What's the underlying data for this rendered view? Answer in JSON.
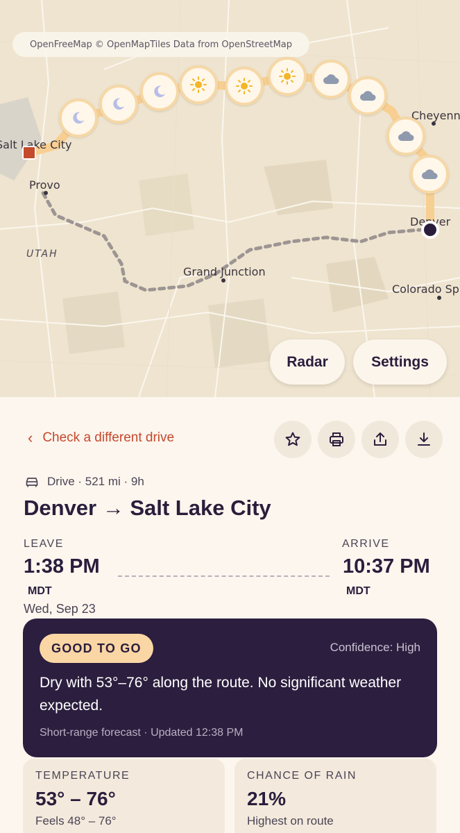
{
  "map": {
    "attribution": "OpenFreeMap © OpenMapTiles Data from OpenStreetMap",
    "cities": [
      "Salt Lake City",
      "Provo",
      "Grand Junction",
      "Cheyenne",
      "Denver",
      "Colorado Springs"
    ],
    "city_labels": {
      "salt_lake": "Salt Lake City",
      "provo": "Provo",
      "grand_junction": "Grand Junction",
      "cheyenne": "Cheyenn",
      "denver": "Denver",
      "colorado_springs": "Colorado Sp"
    },
    "state_label": "UTAH",
    "weather_markers": [
      "moon-icon",
      "moon-icon",
      "moon-icon",
      "sun-icon",
      "sun-icon",
      "sun-icon",
      "cloud-icon",
      "cloud-icon",
      "cloud-icon",
      "cloud-icon"
    ],
    "radar_label": "Radar",
    "settings_label": "Settings"
  },
  "nav": {
    "back_label": "Check a different drive"
  },
  "actions": [
    "star-icon",
    "print-icon",
    "share-icon",
    "download-icon"
  ],
  "trip": {
    "meta": "Drive · 521 mi · 9h",
    "title": "Denver → Salt Lake City",
    "leave_label": "LEAVE",
    "leave_time": "1:38 PM",
    "leave_tz": "MDT",
    "leave_date": "Wed, Sep 23",
    "arrive_label": "ARRIVE",
    "arrive_time": "10:37 PM",
    "arrive_tz": "MDT"
  },
  "verdict": {
    "badge": "GOOD TO GO",
    "confidence": "Confidence: High",
    "summary": "Dry with 53°–76° along the route. No significant weather expected.",
    "updated": "Short-range forecast · Updated 12:38 PM"
  },
  "stats": {
    "temperature": {
      "label": "TEMPERATURE",
      "value": "53° – 76°",
      "sub": "Feels 48° – 76°"
    },
    "rain": {
      "label": "CHANCE OF RAIN",
      "value": "21%",
      "sub": "Highest on route"
    }
  },
  "colors": {
    "accent": "#c4472c",
    "dark": "#2b1e3e",
    "badge": "#fad6a5",
    "route": "#f8cf92"
  }
}
